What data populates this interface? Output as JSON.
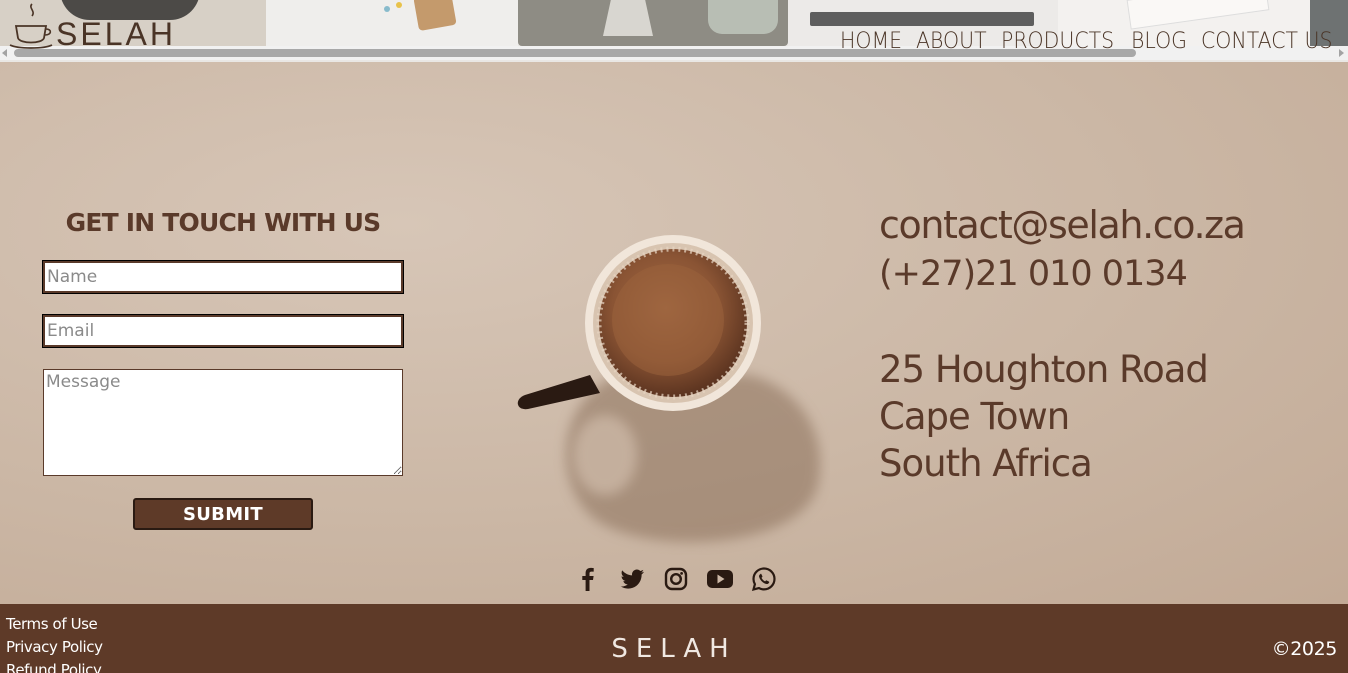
{
  "brand": {
    "name": "SELAH"
  },
  "nav": {
    "items": [
      {
        "label": "HOME"
      },
      {
        "label": "ABOUT"
      },
      {
        "label": "PRODUCTS"
      },
      {
        "label": "BLOG"
      },
      {
        "label": "CONTACT US"
      }
    ]
  },
  "form": {
    "title": "GET IN TOUCH WITH US",
    "name_placeholder": "Name",
    "email_placeholder": "Email",
    "message_placeholder": "Message",
    "submit_label": "SUBMIT"
  },
  "contact": {
    "email": "contact@selah.co.za",
    "phone": "(+27)21 010 0134",
    "address_line1": "25 Houghton Road",
    "address_line2": "Cape Town",
    "address_line3": "South Africa"
  },
  "social": [
    "facebook-icon",
    "twitter-icon",
    "instagram-icon",
    "youtube-icon",
    "whatsapp-icon"
  ],
  "footer": {
    "links": [
      "Terms of Use",
      "Privacy Policy",
      "Refund Policy"
    ],
    "brand": "SELAH",
    "copyright": "©2025"
  },
  "colors": {
    "brown": "#5e3a28",
    "text_brown": "#5a3a2a",
    "section_bg": "#cdb8a6"
  }
}
